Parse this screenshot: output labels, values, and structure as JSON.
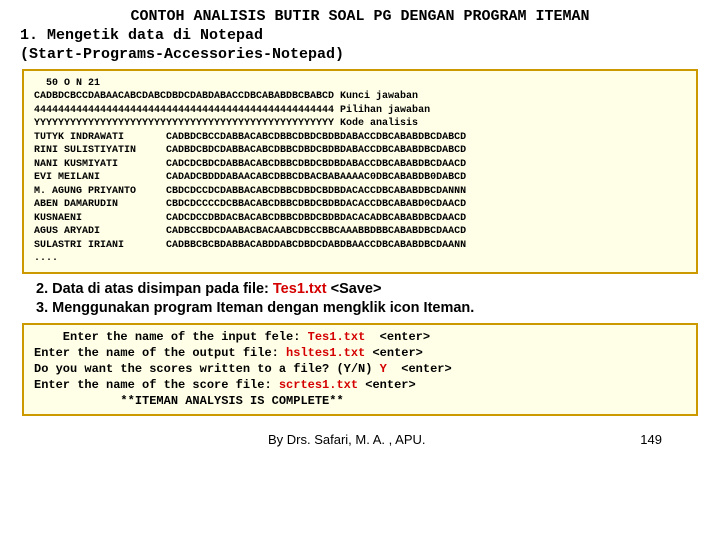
{
  "title": "CONTOH ANALISIS BUTIR SOAL PG DENGAN PROGRAM ITEMAN",
  "step1_line1": "1. Mengetik data di Notepad",
  "step1_line2": "   (Start-Programs-Accessories-Notepad)",
  "databox": {
    "l01": "  50 O N 21",
    "l02": "CADBDCBCCDABAACABCDABCDBDCDABDABACCDBCABABDBCBABCD Kunci jawaban",
    "l03": "44444444444444444444444444444444444444444444444444 Pilihan jawaban",
    "l04": "YYYYYYYYYYYYYYYYYYYYYYYYYYYYYYYYYYYYYYYYYYYYYYYYYY Kode analisis",
    "l05": "TUTYK INDRAWATI       CADBDCBCCDABBACABCDBBCDBDCBDBDABACCDBCABABDBCDABCD",
    "l06": "RINI SULISTIYATIN     CADBDCBDCDABBACABCDBBCDBDCBDBDABACCDBCABABDBCDABCD",
    "l07": "NANI KUSMIYATI        CADCDCBDCDABBACABCDBBCDBDCBDBDABACCDBCABABDBCDAACD",
    "l08": "EVI MEILANI           CADADCBDDDABAACABCDBBCDBACBABAAAAC0DBCABABDB0DABCD",
    "l09": "M. AGUNG PRIYANTO     CBDCDCCDCDABBACABCDBBCDBDCBDBDACACCDBCABABDBCDANNN",
    "l10": "ABEN DAMARUDIN        CBDCDCCCCDCBBACABCDBBCDBDCBDBDACACCDBCABABD0CDAACD",
    "l11": "KUSNAENI              CADCDCCDBDACBACABCDBBCDBDCBDBDACACADBCABABDBCDAACD",
    "l12": "AGUS ARYADI           CADBCCBDCDAABACBACAABCDBCCBBCAAABBDBBCABABDBCDAACD",
    "l13": "SULASTRI IRIANI       CADBBCBCBDABBACABDDABCDBDCDABDBAACCDBCABABDBCDAANN",
    "l14": "...."
  },
  "step2_pre": "2. Data di atas disimpan pada file: ",
  "step2_file": "Tes1.txt",
  "step2_post": " <Save>",
  "step3": "3. Menggunakan program Iteman dengan mengklik icon Iteman.",
  "enter": {
    "l1a": "    Enter the name of the input fele: ",
    "l1b": "Tes1.txt",
    "l1c": "  <enter>",
    "l2a": "Enter the name of the output file: ",
    "l2b": "hsltes1.txt",
    "l2c": " <enter>",
    "l3a": "Do you want the scores written to a file? (Y/N) ",
    "l3b": "Y",
    "l3c": "  <enter>",
    "l4a": "Enter the name of the score file: ",
    "l4b": "scrtes1.txt",
    "l4c": " <enter>",
    "l5": "            **ITEMAN ANALYSIS IS COMPLETE**"
  },
  "footer_author": "By Drs. Safari, M. A. , APU.",
  "footer_page": "149"
}
